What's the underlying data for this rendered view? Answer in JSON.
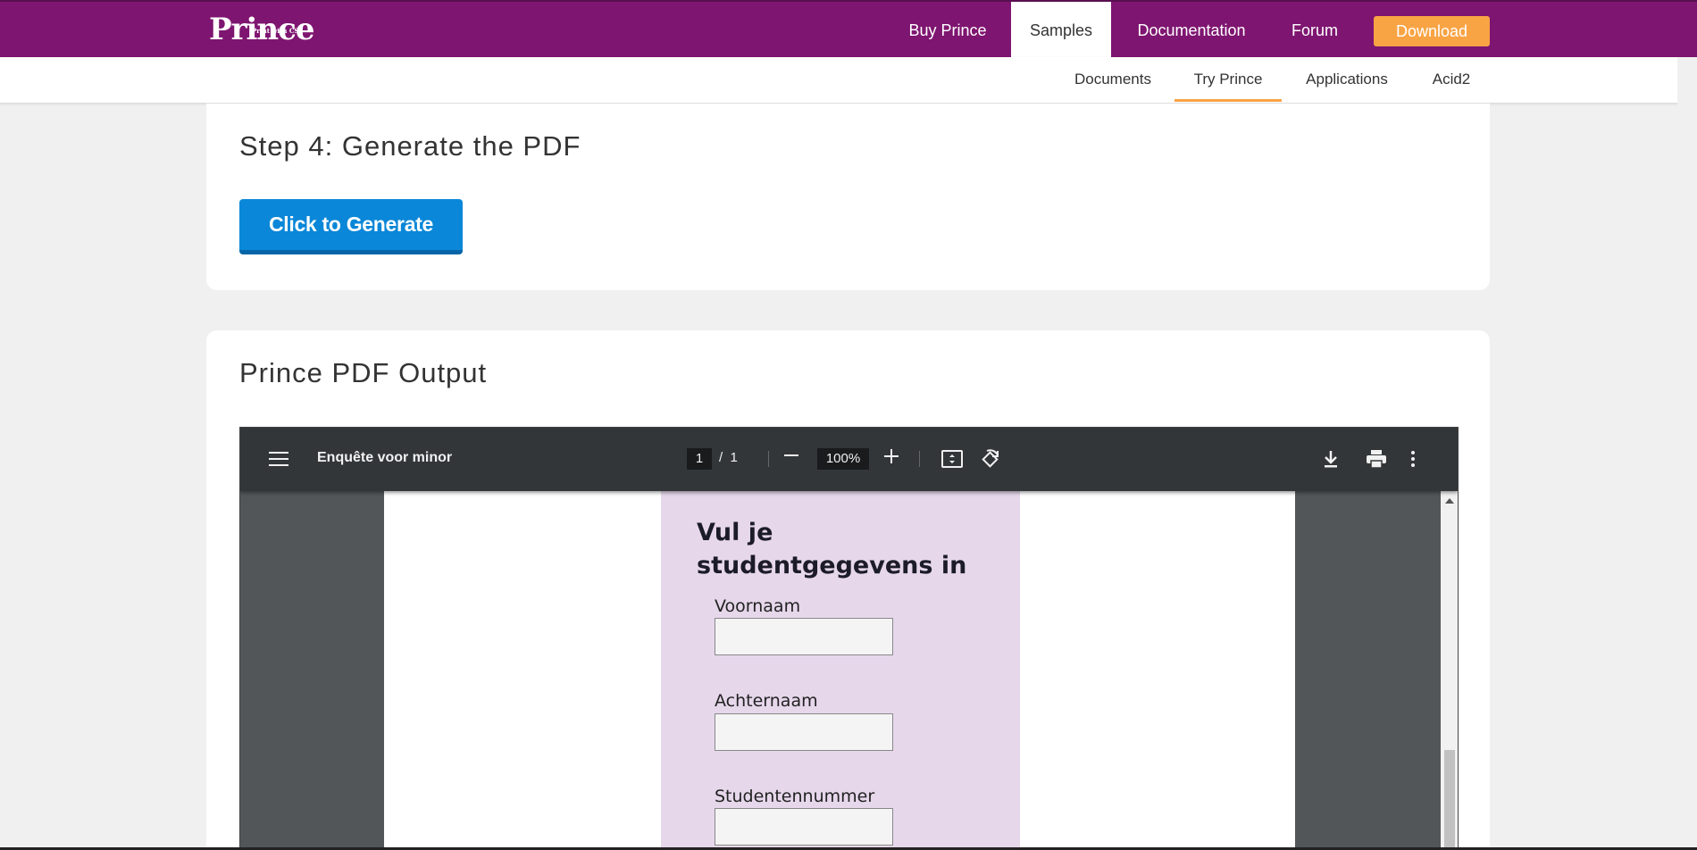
{
  "header": {
    "logo_text": "Prince",
    "logo_tagline": "Print with CSS",
    "nav": [
      "Buy Prince",
      "Samples",
      "Documentation",
      "Forum"
    ],
    "active_nav": "Samples",
    "download_label": "Download",
    "brand_color": "#7e1570",
    "accent_color": "#f8a445"
  },
  "subnav": {
    "items": [
      "Documents",
      "Try Prince",
      "Applications",
      "Acid2"
    ],
    "active": "Try Prince"
  },
  "step4": {
    "title": "Step 4: Generate the PDF",
    "button_label": "Click to Generate"
  },
  "output": {
    "title": "Prince PDF Output"
  },
  "pdf_viewer": {
    "document_title": "Enquête voor minor",
    "current_page": "1",
    "page_separator": "/",
    "total_pages": "1",
    "zoom": "100%",
    "icons": [
      "menu-icon",
      "zoom-out-icon",
      "zoom-in-icon",
      "fit-page-icon",
      "rotate-icon",
      "download-icon",
      "print-icon",
      "more-options-icon"
    ]
  },
  "pdf_page": {
    "form_title": "Vul je studentgegevens in",
    "fields": [
      "Voornaam",
      "Achternaam",
      "Studentennummer"
    ]
  }
}
